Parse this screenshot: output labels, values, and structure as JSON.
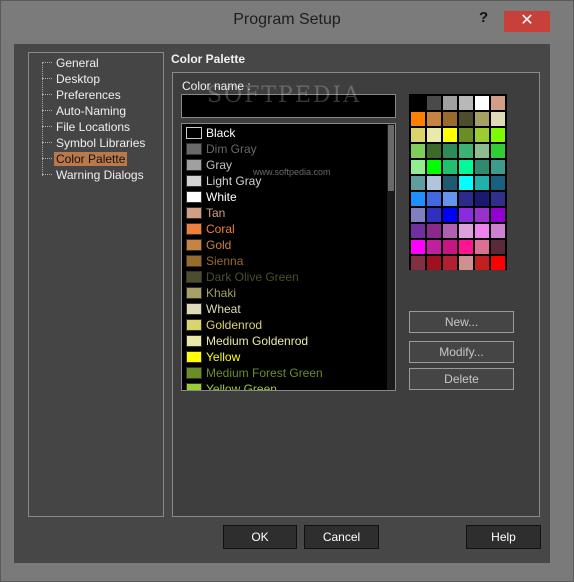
{
  "window": {
    "title": "Program Setup",
    "help_label": "?",
    "close_label": "✕"
  },
  "tree": {
    "items": [
      {
        "label": "General",
        "selected": false
      },
      {
        "label": "Desktop",
        "selected": false
      },
      {
        "label": "Preferences",
        "selected": false
      },
      {
        "label": "Auto-Naming",
        "selected": false
      },
      {
        "label": "File Locations",
        "selected": false
      },
      {
        "label": "Symbol Libraries",
        "selected": false
      },
      {
        "label": "Color Palette",
        "selected": true
      },
      {
        "label": "Warning Dialogs",
        "selected": false
      }
    ]
  },
  "panel": {
    "title": "Color Palette",
    "color_name_label": "Color name :",
    "color_name_value": "",
    "colors": [
      {
        "name": "Black",
        "swatch": "#000000",
        "text": "#ffffff"
      },
      {
        "name": "Dim Gray",
        "swatch": "#696969",
        "text": "#696969"
      },
      {
        "name": "Gray",
        "swatch": "#a0a0a0",
        "text": "#c0c0c0"
      },
      {
        "name": "Light Gray",
        "swatch": "#d3d3d3",
        "text": "#d3d3d3"
      },
      {
        "name": "White",
        "swatch": "#ffffff",
        "text": "#ffffff"
      },
      {
        "name": "Tan",
        "swatch": "#d29e86",
        "text": "#d29e86"
      },
      {
        "name": "Coral",
        "swatch": "#f07f3a",
        "text": "#f07f3a"
      },
      {
        "name": "Gold",
        "swatch": "#c98340",
        "text": "#c98340"
      },
      {
        "name": "Sienna",
        "swatch": "#9a6a2a",
        "text": "#9a6a2a"
      },
      {
        "name": "Dark Olive Green",
        "swatch": "#4d4d2e",
        "text": "#4d4d2e"
      },
      {
        "name": "Khaki",
        "swatch": "#a7a065",
        "text": "#a7a065"
      },
      {
        "name": "Wheat",
        "swatch": "#dedbb6",
        "text": "#dedbb6"
      },
      {
        "name": "Goldenrod",
        "swatch": "#dbd46a",
        "text": "#dbd46a"
      },
      {
        "name": "Medium Goldenrod",
        "swatch": "#eaeaa8",
        "text": "#eaeaa8"
      },
      {
        "name": "Yellow",
        "swatch": "#ffff00",
        "text": "#ffff00"
      },
      {
        "name": "Medium Forest Green",
        "swatch": "#6b8e23",
        "text": "#6b8e23"
      },
      {
        "name": "Yellow Green",
        "swatch": "#9acd32",
        "text": "#9acd32"
      }
    ],
    "palette_grid": [
      [
        "#000000",
        "#4a4a4a",
        "#a0a0a0",
        "#b8b8b8",
        "#ffffff",
        "#d29e86"
      ],
      [
        "#ff7f00",
        "#c98340",
        "#9a6a2a",
        "#4d4d2e",
        "#a7a065",
        "#dedbb6"
      ],
      [
        "#dbd46a",
        "#eaeaa8",
        "#ffff00",
        "#6b8e23",
        "#9acd32",
        "#7cfc00"
      ],
      [
        "#7fce5b",
        "#3b6b2a",
        "#2e8b57",
        "#3cb371",
        "#8fbc8f",
        "#32cd32"
      ],
      [
        "#90ee90",
        "#00ff00",
        "#20c070",
        "#00fa9a",
        "#2e8b6f",
        "#3c9b8a"
      ],
      [
        "#5f9ea0",
        "#b0c4de",
        "#1e5a70",
        "#00ffff",
        "#20b2aa",
        "#1a6080"
      ],
      [
        "#1e90ff",
        "#4169e1",
        "#6495ed",
        "#2b2b8b",
        "#191970",
        "#30308a"
      ],
      [
        "#8080c0",
        "#3030c0",
        "#0000ff",
        "#8a2be2",
        "#9932cc",
        "#9400d3"
      ],
      [
        "#7030a0",
        "#8b2a8b",
        "#b060b0",
        "#dda0dd",
        "#ee82ee",
        "#d080d0"
      ],
      [
        "#ff00ff",
        "#c020a0",
        "#c71585",
        "#ff1493",
        "#db7093",
        "#5a2a3a"
      ],
      [
        "#803040",
        "#a01020",
        "#b02030",
        "#d09090",
        "#c02020",
        "#ff0000"
      ]
    ],
    "buttons": {
      "new": "New...",
      "modify": "Modify...",
      "delete": "Delete"
    }
  },
  "footer": {
    "ok": "OK",
    "cancel": "Cancel",
    "help": "Help"
  },
  "watermark": {
    "text": "SOFTPEDIA",
    "url": "www.softpedia.com"
  }
}
